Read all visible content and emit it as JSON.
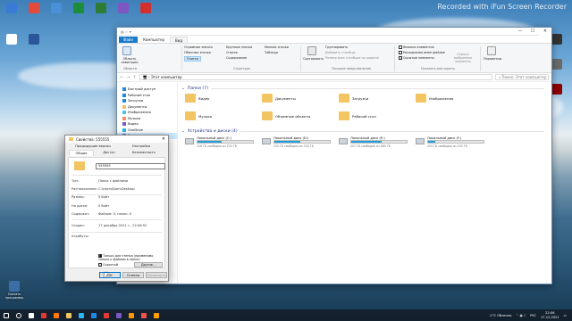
{
  "watermark": "Recorded with iFun Screen Recorder",
  "desktop_icons": [
    {
      "label": "",
      "color": "#3a7bd5"
    },
    {
      "label": "",
      "color": "#e24a3b"
    },
    {
      "label": "",
      "color": "#4a90d9"
    },
    {
      "label": "",
      "color": "#1a8e3a"
    },
    {
      "label": "",
      "color": "#2e7d32"
    },
    {
      "label": "",
      "color": "#7e57c2"
    },
    {
      "label": "",
      "color": "#d32f2f"
    },
    {
      "label": "",
      "color": "#fff"
    },
    {
      "label": "",
      "color": "#2b579a"
    }
  ],
  "desktop_right_icons": [
    {
      "label": "",
      "color": "#333"
    },
    {
      "label": "",
      "color": "#6b6b6b"
    },
    {
      "label": "",
      "color": "#8b0000"
    }
  ],
  "desktop_bottom_icon": {
    "label": "Скачать программы",
    "color": "#3a6ea5"
  },
  "explorer": {
    "tabs": [
      "Файл",
      "Компьютер",
      "Вид"
    ],
    "ribbon": {
      "nav_pane": "Область навигации",
      "panes_group": "Области",
      "layout_items": [
        "Огромные значки",
        "Крупные значки",
        "Обычные значки",
        "Мелкие значки",
        "Список",
        "Таблица",
        "Плитка",
        "Содержимое"
      ],
      "layout_group": "Структура",
      "sort": "Сортировать",
      "view_items": [
        "Группировать",
        "Добавить столбцы",
        "Размер всех столбцов по ширине"
      ],
      "view_group": "Текущее представление",
      "show_items": [
        "Флажки элементов",
        "Расширения имен файлов",
        "Скрытые элементы"
      ],
      "hide_selected": "Скрыть выбранные элементы",
      "show_group": "Показать или скрыть",
      "options": "Параметры"
    },
    "address": "Этот компьютер",
    "search_placeholder": "Поиск: Этот компьютер",
    "nav_items": [
      "Быстрый доступ",
      "Рабочий стол",
      "Загрузки",
      "Документы",
      "Изображения",
      "Музыка",
      "Видео",
      "OneDrive",
      "Этот компьютер",
      "Сеть"
    ],
    "folders_header": "Папки (7)",
    "folders": [
      "Видео",
      "Документы",
      "Загрузки",
      "Изображения",
      "Музыка",
      "Объемные объекты",
      "Рабочий стол"
    ],
    "drives_header": "Устройства и диски (4)",
    "drives": [
      {
        "name": "Локальный диск (C:)",
        "free": "129 ГБ свободно из 231 ГБ",
        "used_fraction": 0.44
      },
      {
        "name": "Локальный диск (D:)",
        "free": "122 ГБ свободно из 232 ГБ",
        "used_fraction": 0.47
      },
      {
        "name": "Локальный диск (E:)",
        "free": "207 ГБ свободно из 465 ГБ",
        "used_fraction": 0.55
      },
      {
        "name": "Локальный диск (F:)",
        "free": "203 ГБ свободно из 232 ГБ",
        "used_fraction": 0.13
      }
    ]
  },
  "properties": {
    "title": "Свойства: 555555",
    "tabs": [
      "Предыдущие версии",
      "Настройка",
      "Общие",
      "Доступ",
      "Безопасность"
    ],
    "name_value": "555555",
    "rows": [
      {
        "label": "Тип:",
        "value": "Папка с файлами"
      },
      {
        "label": "Расположение:",
        "value": "C:\\Users\\Dom\\Desktop"
      },
      {
        "label": "Размер:",
        "value": "0 байт"
      },
      {
        "label": "На диске:",
        "value": "0 байт"
      },
      {
        "label": "Содержит:",
        "value": "Файлов: 0; папок: 0"
      },
      {
        "label": "Создан:",
        "value": "17 декабря 2021 г., 22:06:52"
      },
      {
        "label": "Атрибуты:",
        "value": ""
      }
    ],
    "readonly_label": "Только для чтения (применимо только к файлам в папке)",
    "hidden_label": "Скрытый",
    "other_button": "Другие...",
    "ok": "ОК",
    "cancel": "Отмена",
    "apply": "Применить"
  },
  "taskbar": {
    "weather": "-1°C Облачно",
    "lang": "РУС",
    "time": "22:06",
    "date": "17.12.2021",
    "apps": [
      {
        "name": "start-icon",
        "color": "#fff"
      },
      {
        "name": "search-icon",
        "color": "#fff"
      },
      {
        "name": "taskview-icon",
        "color": "#fff"
      },
      {
        "name": "recorder-icon",
        "color": "#e53935"
      },
      {
        "name": "firefox-icon",
        "color": "#ff7a00"
      },
      {
        "name": "explorer-icon",
        "color": "#f2c462"
      },
      {
        "name": "browser-icon",
        "color": "#29b6f6"
      },
      {
        "name": "edge-icon",
        "color": "#1e88e5"
      },
      {
        "name": "chrome-icon",
        "color": "#e53935"
      },
      {
        "name": "viber-icon",
        "color": "#7e57c2"
      },
      {
        "name": "vlc-icon",
        "color": "#ff9800"
      },
      {
        "name": "media-icon",
        "color": "#ef5350"
      },
      {
        "name": "app-icon",
        "color": "#ffa000"
      }
    ]
  }
}
